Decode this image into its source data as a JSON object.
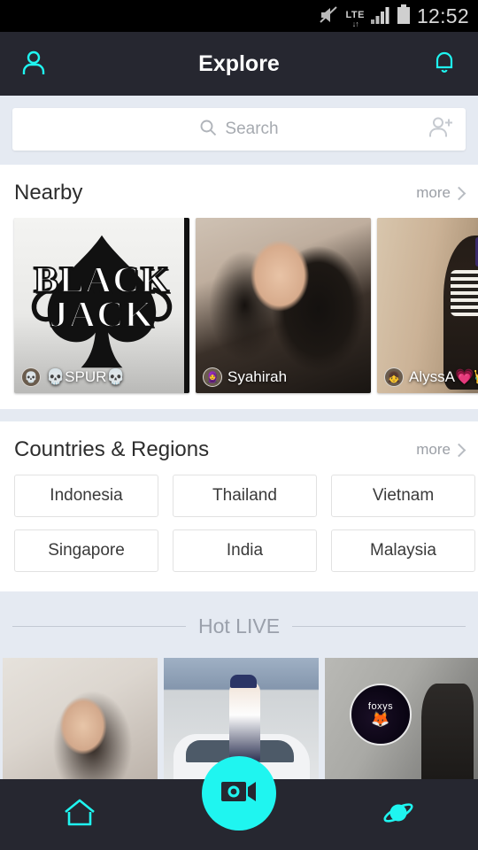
{
  "statusbar": {
    "time": "12:52",
    "network_label": "LTE",
    "network_arrows": "↓↑",
    "icons": [
      "mute-icon",
      "lte-icon",
      "signal-icon",
      "battery-icon"
    ]
  },
  "appbar": {
    "title": "Explore",
    "left_icon": "profile-icon",
    "right_icon": "bell-icon"
  },
  "search": {
    "placeholder": "Search",
    "value": "",
    "search_icon": "search-icon",
    "add_friend_icon": "add-person-icon"
  },
  "nearby": {
    "title": "Nearby",
    "more_label": "more",
    "cards": [
      {
        "name": "💀SPUR💀",
        "art_line1": "BLACK",
        "art_line2": "JACK",
        "avatar_glyph": "💀"
      },
      {
        "name": "Syahirah",
        "avatar_glyph": "🧕"
      },
      {
        "name": "AlyssA💗👑",
        "avatar_glyph": "👧"
      }
    ]
  },
  "countries": {
    "title": "Countries & Regions",
    "more_label": "more",
    "rows": [
      [
        "Indonesia",
        "Thailand",
        "Vietnam"
      ],
      [
        "Singapore",
        "India",
        "Malaysia"
      ]
    ]
  },
  "hot_live": {
    "title": "Hot LIVE",
    "cards": [
      {
        "badge": ""
      },
      {
        "badge": ""
      },
      {
        "badge": "foxys",
        "badge_glyph": "🦊"
      }
    ]
  },
  "bottomnav": {
    "home_icon": "home-icon",
    "fab_icon": "video-camera-icon",
    "discover_icon": "planet-icon"
  },
  "colors": {
    "accent": "#1ff5f0",
    "appbar_bg": "#262730",
    "page_bg": "#e5eaf2",
    "card_bg": "#ffffff",
    "muted_text": "#9aa0ab"
  }
}
